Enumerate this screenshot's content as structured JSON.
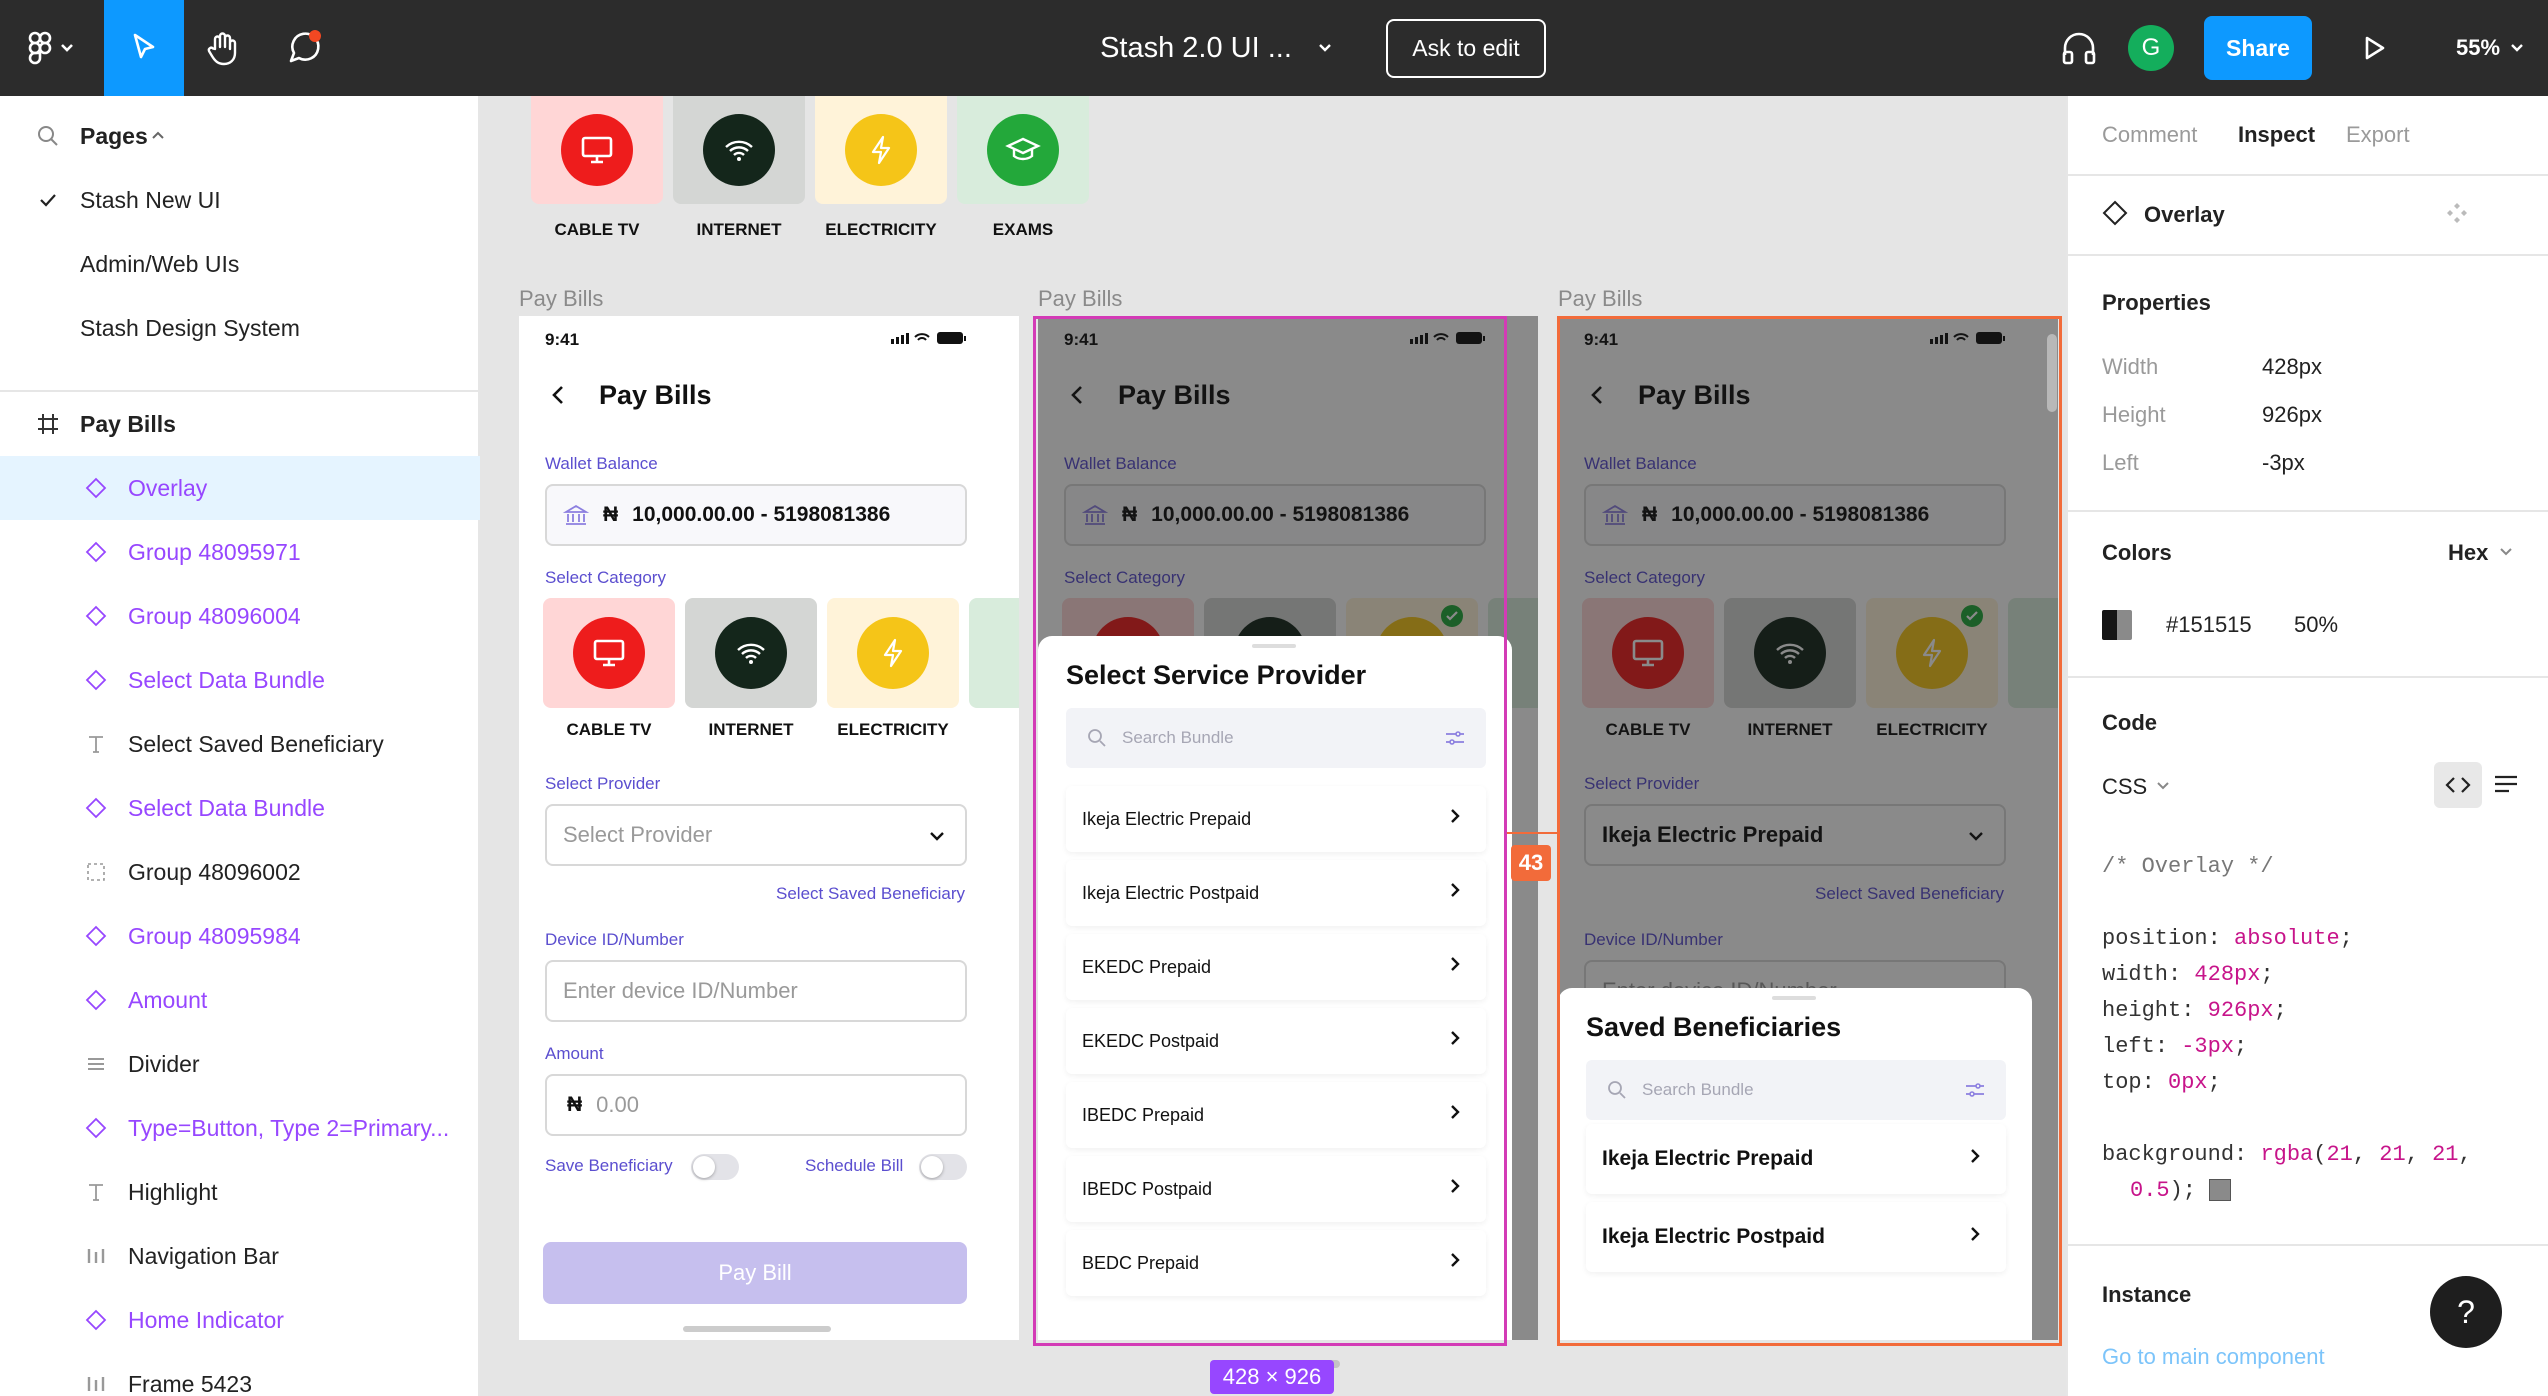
{
  "toolbar": {
    "file_title": "Stash 2.0 UI ...",
    "ask_to_edit": "Ask to edit",
    "avatar_initial": "G",
    "share": "Share",
    "zoom": "55%"
  },
  "pages_panel": {
    "header": "Pages",
    "pages": [
      {
        "label": "Stash New UI",
        "selected": true
      },
      {
        "label": "Admin/Web UIs",
        "selected": false
      },
      {
        "label": "Stash Design System",
        "selected": false
      }
    ]
  },
  "layers": {
    "frame": "Pay Bills",
    "items": [
      {
        "label": "Overlay",
        "icon": "component-instance-icon",
        "purple": true
      },
      {
        "label": "Group 48095971",
        "icon": "component-instance-icon",
        "purple": true
      },
      {
        "label": "Group 48096004",
        "icon": "component-instance-icon",
        "purple": true
      },
      {
        "label": "Select Data Bundle",
        "icon": "component-instance-icon",
        "purple": true
      },
      {
        "label": "Select Saved Beneficiary",
        "icon": "text-icon",
        "purple": false
      },
      {
        "label": "Select Data Bundle",
        "icon": "component-instance-icon",
        "purple": true
      },
      {
        "label": "Group 48096002",
        "icon": "group-icon",
        "purple": false
      },
      {
        "label": "Group 48095984",
        "icon": "component-instance-icon",
        "purple": true
      },
      {
        "label": "Amount",
        "icon": "component-instance-icon",
        "purple": true
      },
      {
        "label": "Divider",
        "icon": "divider-icon",
        "purple": false
      },
      {
        "label": "Type=Button, Type 2=Primary...",
        "icon": "component-instance-icon",
        "purple": true
      },
      {
        "label": "Highlight",
        "icon": "text-icon",
        "purple": false
      },
      {
        "label": "Navigation Bar",
        "icon": "columns-icon",
        "purple": false
      },
      {
        "label": "Home Indicator",
        "icon": "component-instance-icon",
        "purple": true
      },
      {
        "label": "Frame 5423",
        "icon": "columns-icon",
        "purple": false
      }
    ]
  },
  "inspect": {
    "tabs": [
      "Comment",
      "Inspect",
      "Export"
    ],
    "active_tab": "Inspect",
    "layer_name": "Overlay",
    "properties_title": "Properties",
    "properties": [
      {
        "k": "Width",
        "v": "428px"
      },
      {
        "k": "Height",
        "v": "926px"
      },
      {
        "k": "Left",
        "v": "-3px"
      }
    ],
    "colors_title": "Colors",
    "color_format": "Hex",
    "color_hex": "#151515",
    "color_opacity": "50%",
    "code_title": "Code",
    "code_lang": "CSS",
    "code_comment": "/* Overlay */",
    "code_lines": [
      {
        "p": "position",
        "v": "absolute"
      },
      {
        "p": "width",
        "v": "428px"
      },
      {
        "p": "height",
        "v": "926px"
      },
      {
        "p": "left",
        "v": "-3px"
      },
      {
        "p": "top",
        "v": "0px"
      }
    ],
    "code_bg_prop": "background",
    "code_bg_fn": "rgba",
    "code_bg_args": [
      "21",
      "21",
      "21",
      "0.5"
    ],
    "instance_title": "Instance",
    "goto_main": "Go to main component",
    "help": "?"
  },
  "canvas": {
    "top_categories": [
      {
        "label": "CABLE TV",
        "bg": "#ffd6d6",
        "circle": "#ee1c1c"
      },
      {
        "label": "INTERNET",
        "bg": "#d4d6d4",
        "circle": "#14261b"
      },
      {
        "label": "ELECTRICITY",
        "bg": "#fff3d9",
        "circle": "#f5c518"
      },
      {
        "label": "EXAMS",
        "bg": "#d8ecdc",
        "circle": "#23a83a"
      }
    ],
    "frame_label": "Pay Bills",
    "time": "9:41",
    "title": "Pay Bills",
    "wallet_label": "Wallet Balance",
    "currency": "₦",
    "wallet_value": "10,000.00.00 - 5198081386",
    "select_category": "Select Category",
    "categories": [
      "CABLE TV",
      "INTERNET",
      "ELECTRICITY"
    ],
    "select_provider_label": "Select Provider",
    "select_provider_placeholder": "Select Provider",
    "selected_provider": "Ikeja Electric Prepaid",
    "saved_beneficiary_link": "Select Saved Beneficiary",
    "device_label": "Device ID/Number",
    "device_placeholder": "Enter device ID/Number",
    "amount_label": "Amount",
    "amount_placeholder": "0.00",
    "save_beneficiary": "Save Beneficiary",
    "schedule_bill": "Schedule Bill",
    "pay_button": "Pay Bill",
    "sheet1_title": "Select Service Provider",
    "search_placeholder": "Search Bundle",
    "providers": [
      "Ikeja Electric Prepaid",
      "Ikeja Electric Postpaid",
      "EKEDC Prepaid",
      "EKEDC Postpaid",
      "IBEDC Prepaid",
      "IBEDC Postpaid",
      "BEDC Prepaid"
    ],
    "sheet2_title": "Saved Beneficiaries",
    "beneficiaries": [
      "Ikeja Electric Prepaid",
      "Ikeja Electric Postpaid"
    ],
    "spacing_badge": "43",
    "size_badge": "428 × 926"
  }
}
